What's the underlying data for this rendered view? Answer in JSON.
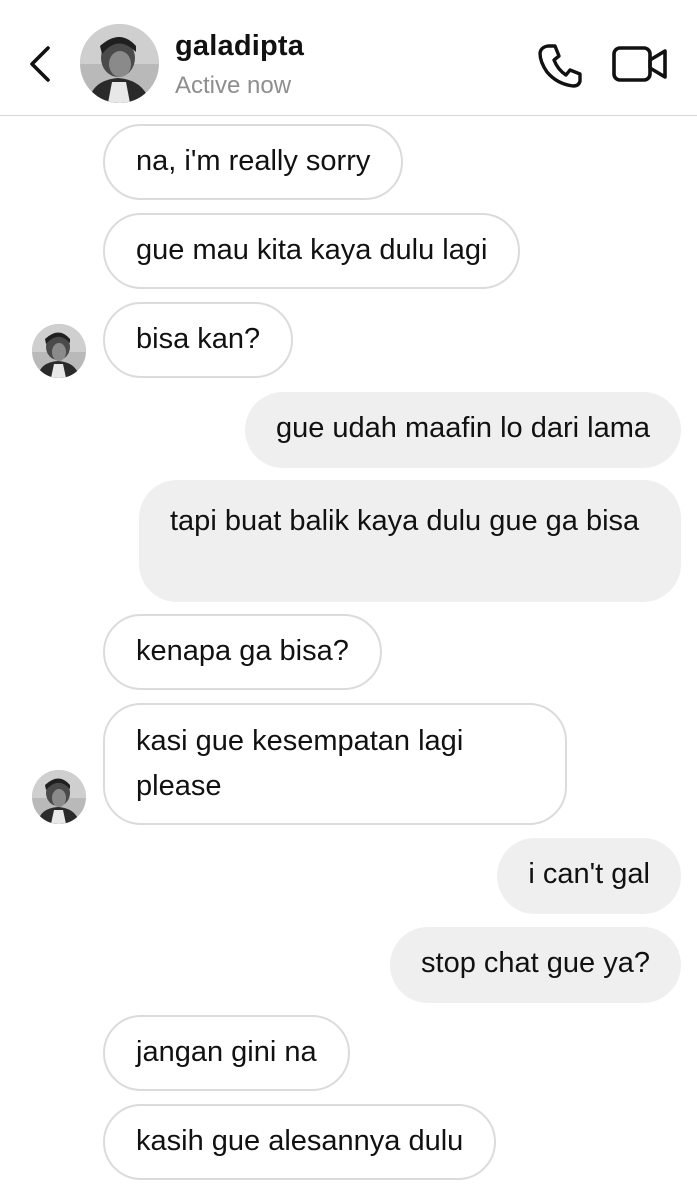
{
  "header": {
    "username": "galadipta",
    "status": "Active now",
    "back_icon": "chevron-left-icon",
    "call_icon": "phone-icon",
    "video_icon": "video-camera-icon"
  },
  "messages": [
    {
      "side": "in",
      "text": "na, i'm really sorry"
    },
    {
      "side": "in",
      "text": "gue mau kita kaya dulu lagi"
    },
    {
      "side": "in",
      "text": "bisa kan?"
    },
    {
      "side": "out",
      "text": "gue udah maafin lo dari lama"
    },
    {
      "side": "out",
      "text": "tapi buat balik kaya dulu gue ga bisa"
    },
    {
      "side": "in",
      "text": "kenapa ga bisa?"
    },
    {
      "side": "in",
      "text": "kasi gue kesempatan lagi please"
    },
    {
      "side": "out",
      "text": "i can't gal"
    },
    {
      "side": "out",
      "text": "stop chat gue ya?"
    },
    {
      "side": "in",
      "text": "jangan gini na"
    },
    {
      "side": "in",
      "text": "kasih gue alesannya dulu"
    }
  ],
  "colors": {
    "incoming_bubble_border": "#dbdbdb",
    "outgoing_bubble_bg": "#efefef",
    "status_text": "#8e8e8e"
  }
}
